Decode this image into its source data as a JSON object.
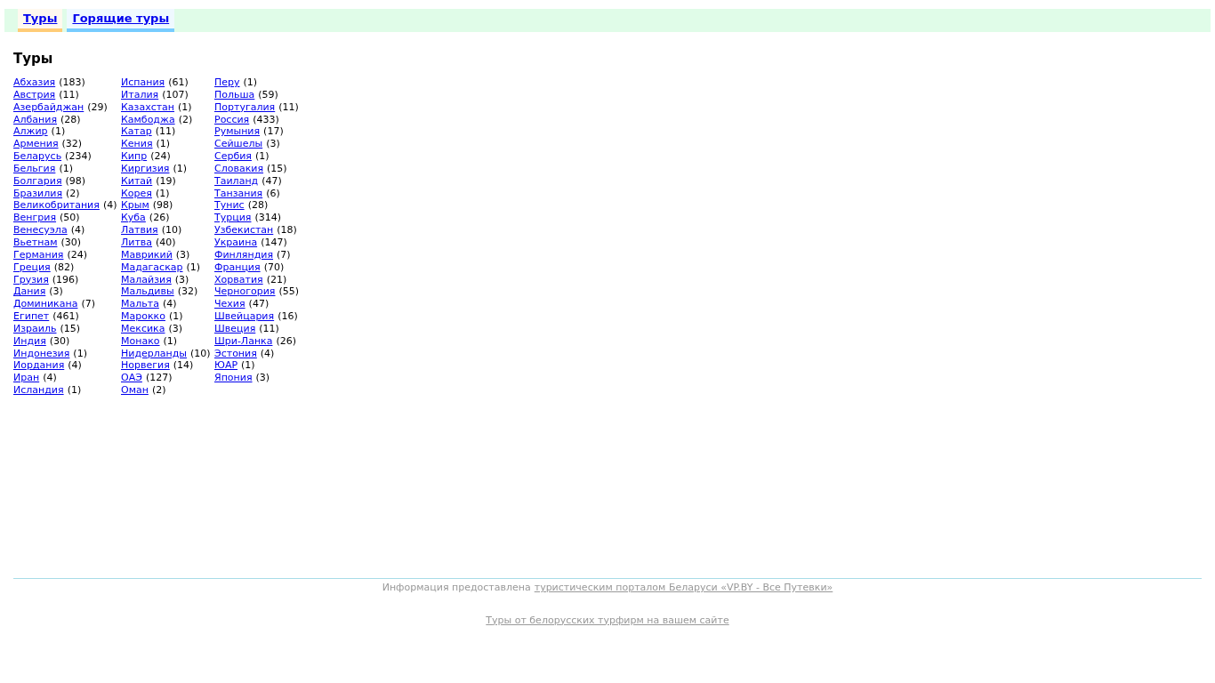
{
  "tabs": [
    {
      "label": "Туры",
      "color": "#ffcc77"
    },
    {
      "label": "Горящие туры",
      "color": "#77ccff"
    }
  ],
  "heading": "Туры",
  "columns": [
    [
      {
        "name": "Абхазия",
        "count": "(183)"
      },
      {
        "name": "Австрия",
        "count": "(11)"
      },
      {
        "name": "Азербайджан",
        "count": "(29)"
      },
      {
        "name": "Албания",
        "count": "(28)"
      },
      {
        "name": "Алжир",
        "count": "(1)"
      },
      {
        "name": "Армения",
        "count": "(32)"
      },
      {
        "name": "Беларусь",
        "count": "(234)"
      },
      {
        "name": "Бельгия",
        "count": "(1)"
      },
      {
        "name": "Болгария",
        "count": "(98)"
      },
      {
        "name": "Бразилия",
        "count": "(2)"
      },
      {
        "name": "Великобритания",
        "count": "(4)"
      },
      {
        "name": "Венгрия",
        "count": "(50)"
      },
      {
        "name": "Венесуэла",
        "count": "(4)"
      },
      {
        "name": "Вьетнам",
        "count": "(30)"
      },
      {
        "name": "Германия",
        "count": "(24)"
      },
      {
        "name": "Греция",
        "count": "(82)"
      },
      {
        "name": "Грузия",
        "count": "(196)"
      },
      {
        "name": "Дания",
        "count": "(3)"
      },
      {
        "name": "Доминикана",
        "count": "(7)"
      },
      {
        "name": "Египет",
        "count": "(461)"
      },
      {
        "name": "Израиль",
        "count": "(15)"
      },
      {
        "name": "Индия",
        "count": "(30)"
      },
      {
        "name": "Индонезия",
        "count": "(1)"
      },
      {
        "name": "Иордания",
        "count": "(4)"
      },
      {
        "name": "Иран",
        "count": "(4)"
      },
      {
        "name": "Исландия",
        "count": "(1)"
      }
    ],
    [
      {
        "name": "Испания",
        "count": "(61)"
      },
      {
        "name": "Италия",
        "count": "(107)"
      },
      {
        "name": "Казахстан",
        "count": "(1)"
      },
      {
        "name": "Камбоджа",
        "count": "(2)"
      },
      {
        "name": "Катар",
        "count": "(11)"
      },
      {
        "name": "Кения",
        "count": "(1)"
      },
      {
        "name": "Кипр",
        "count": "(24)"
      },
      {
        "name": "Киргизия",
        "count": "(1)"
      },
      {
        "name": "Китай",
        "count": "(19)"
      },
      {
        "name": "Корея",
        "count": "(1)"
      },
      {
        "name": "Крым",
        "count": "(98)"
      },
      {
        "name": "Куба",
        "count": "(26)"
      },
      {
        "name": "Латвия",
        "count": "(10)"
      },
      {
        "name": "Литва",
        "count": "(40)"
      },
      {
        "name": "Маврикий",
        "count": "(3)"
      },
      {
        "name": "Мадагаскар",
        "count": "(1)"
      },
      {
        "name": "Малайзия",
        "count": "(3)"
      },
      {
        "name": "Мальдивы",
        "count": "(32)"
      },
      {
        "name": "Мальта",
        "count": "(4)"
      },
      {
        "name": "Марокко",
        "count": "(1)"
      },
      {
        "name": "Мексика",
        "count": "(3)"
      },
      {
        "name": "Монако",
        "count": "(1)"
      },
      {
        "name": "Нидерланды",
        "count": "(10)"
      },
      {
        "name": "Норвегия",
        "count": "(14)"
      },
      {
        "name": "ОАЭ",
        "count": "(127)"
      },
      {
        "name": "Оман",
        "count": "(2)"
      }
    ],
    [
      {
        "name": "Перу",
        "count": "(1)"
      },
      {
        "name": "Польша",
        "count": "(59)"
      },
      {
        "name": "Португалия",
        "count": "(11)"
      },
      {
        "name": "Россия",
        "count": "(433)"
      },
      {
        "name": "Румыния",
        "count": "(17)"
      },
      {
        "name": "Сейшелы",
        "count": "(3)"
      },
      {
        "name": "Сербия",
        "count": "(1)"
      },
      {
        "name": "Словакия",
        "count": "(15)"
      },
      {
        "name": "Таиланд",
        "count": "(47)"
      },
      {
        "name": "Танзания",
        "count": "(6)"
      },
      {
        "name": "Тунис",
        "count": "(28)"
      },
      {
        "name": "Турция",
        "count": "(314)"
      },
      {
        "name": "Узбекистан",
        "count": "(18)"
      },
      {
        "name": "Украина",
        "count": "(147)"
      },
      {
        "name": "Финляндия",
        "count": "(7)"
      },
      {
        "name": "Франция",
        "count": "(70)"
      },
      {
        "name": "Хорватия",
        "count": "(21)"
      },
      {
        "name": "Черногория",
        "count": "(55)"
      },
      {
        "name": "Чехия",
        "count": "(47)"
      },
      {
        "name": "Швейцария",
        "count": "(16)"
      },
      {
        "name": "Швеция",
        "count": "(11)"
      },
      {
        "name": "Шри-Ланка",
        "count": "(26)"
      },
      {
        "name": "Эстония",
        "count": "(4)"
      },
      {
        "name": "ЮАР",
        "count": "(1)"
      },
      {
        "name": "Япония",
        "count": "(3)"
      }
    ]
  ],
  "footer": {
    "text": "Информация предоставлена",
    "link": "туристическим порталом Беларуси «VP.BY - Все Путевки»",
    "second_link": "Туры от белорусских турфирм на вашем сайте"
  }
}
